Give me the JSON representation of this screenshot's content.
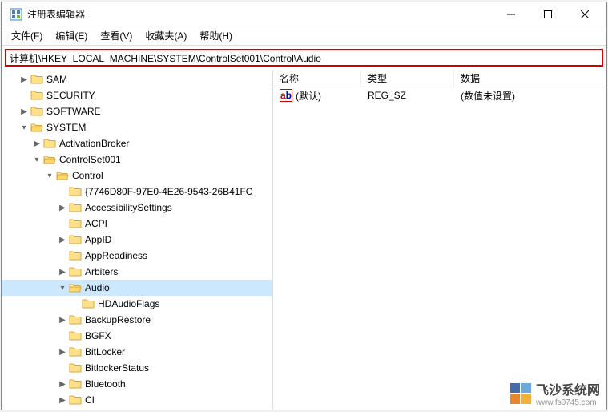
{
  "window": {
    "title": "注册表编辑器"
  },
  "menu": {
    "file": "文件(F)",
    "edit": "编辑(E)",
    "view": "查看(V)",
    "favorites": "收藏夹(A)",
    "help": "帮助(H)"
  },
  "address": "计算机\\HKEY_LOCAL_MACHINE\\SYSTEM\\ControlSet001\\Control\\Audio",
  "tree": [
    {
      "level": 1,
      "expander": ">",
      "open": false,
      "label": "SAM"
    },
    {
      "level": 1,
      "expander": "",
      "open": false,
      "label": "SECURITY"
    },
    {
      "level": 1,
      "expander": ">",
      "open": false,
      "label": "SOFTWARE"
    },
    {
      "level": 1,
      "expander": "v",
      "open": true,
      "label": "SYSTEM"
    },
    {
      "level": 2,
      "expander": ">",
      "open": false,
      "label": "ActivationBroker"
    },
    {
      "level": 2,
      "expander": "v",
      "open": true,
      "label": "ControlSet001"
    },
    {
      "level": 3,
      "expander": "v",
      "open": true,
      "label": "Control"
    },
    {
      "level": 4,
      "expander": "",
      "open": false,
      "label": "{7746D80F-97E0-4E26-9543-26B41FC"
    },
    {
      "level": 4,
      "expander": ">",
      "open": false,
      "label": "AccessibilitySettings"
    },
    {
      "level": 4,
      "expander": "",
      "open": false,
      "label": "ACPI"
    },
    {
      "level": 4,
      "expander": ">",
      "open": false,
      "label": "AppID"
    },
    {
      "level": 4,
      "expander": "",
      "open": false,
      "label": "AppReadiness"
    },
    {
      "level": 4,
      "expander": ">",
      "open": false,
      "label": "Arbiters"
    },
    {
      "level": 4,
      "expander": "v",
      "open": true,
      "label": "Audio",
      "selected": true
    },
    {
      "level": 5,
      "expander": "",
      "open": false,
      "label": "HDAudioFlags"
    },
    {
      "level": 4,
      "expander": ">",
      "open": false,
      "label": "BackupRestore"
    },
    {
      "level": 4,
      "expander": "",
      "open": false,
      "label": "BGFX"
    },
    {
      "level": 4,
      "expander": ">",
      "open": false,
      "label": "BitLocker"
    },
    {
      "level": 4,
      "expander": "",
      "open": false,
      "label": "BitlockerStatus"
    },
    {
      "level": 4,
      "expander": ">",
      "open": false,
      "label": "Bluetooth"
    },
    {
      "level": 4,
      "expander": ">",
      "open": false,
      "label": "CI"
    }
  ],
  "columns": {
    "name": "名称",
    "type": "类型",
    "data": "数据"
  },
  "rows": [
    {
      "name": "(默认)",
      "type": "REG_SZ",
      "data": "(数值未设置)"
    }
  ],
  "watermark": {
    "brand": "飞沙系统网",
    "url": "www.fs0745.com"
  }
}
